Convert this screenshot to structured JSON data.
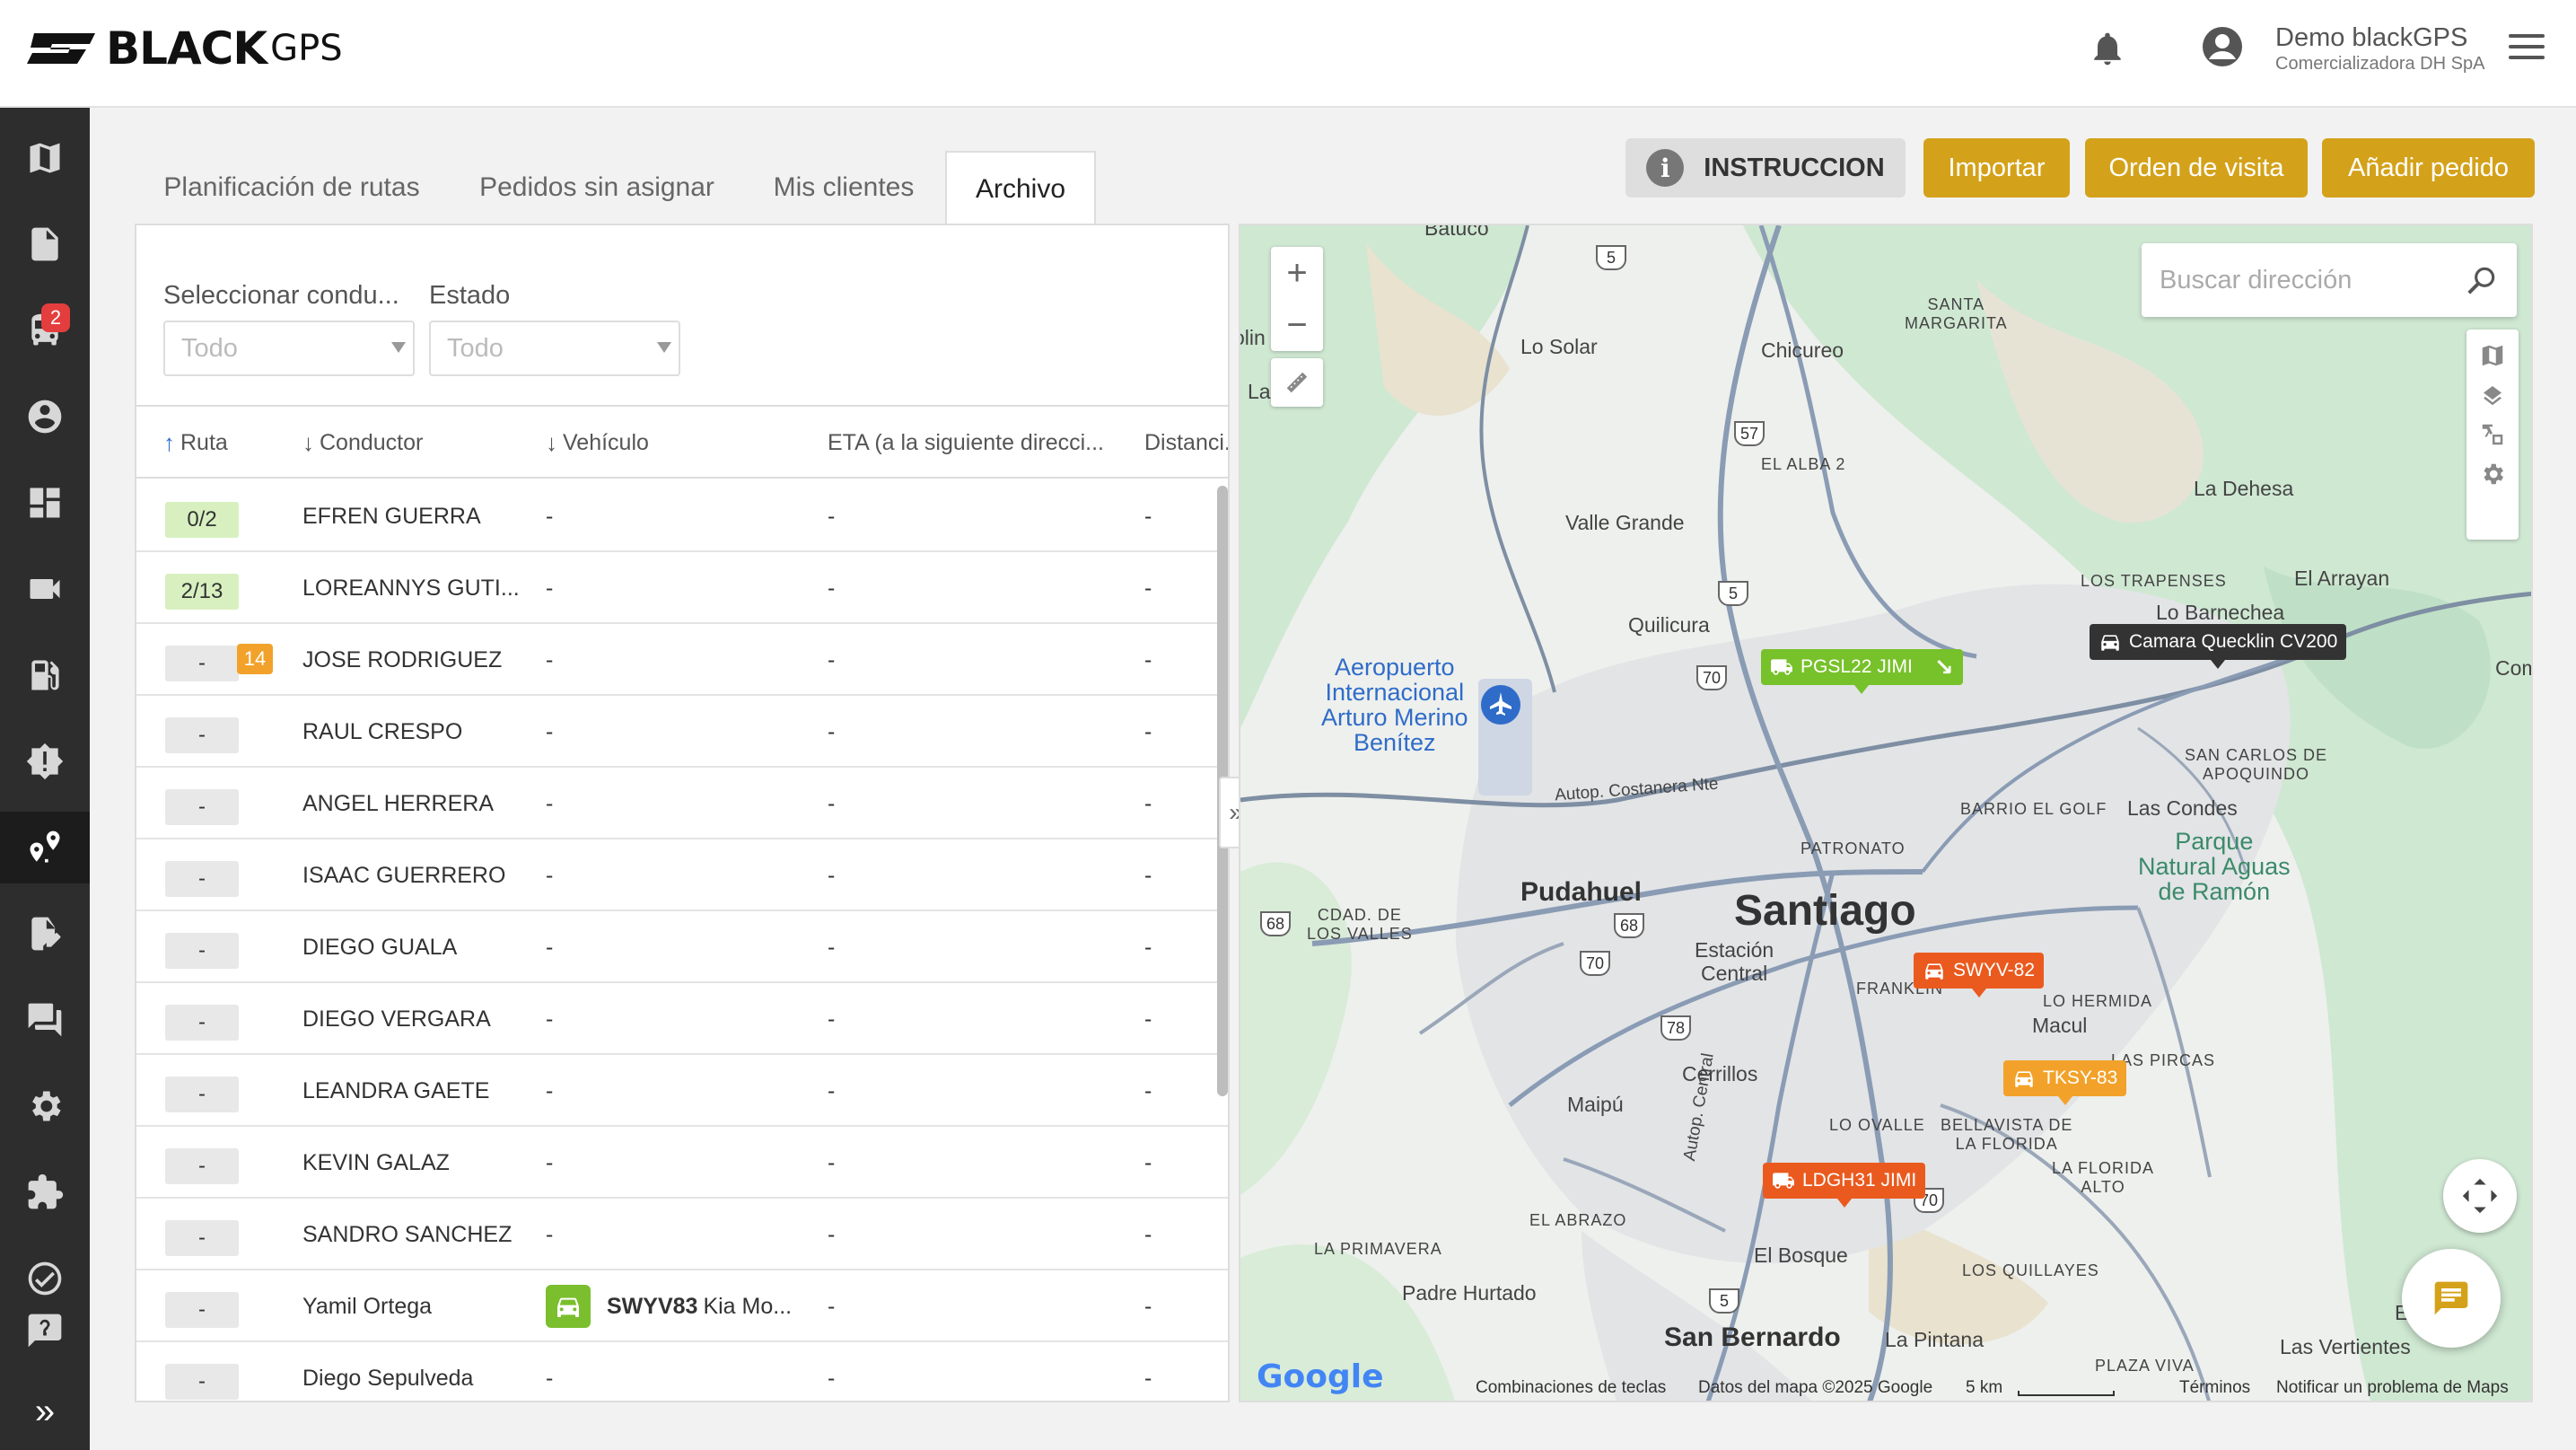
{
  "brand": {
    "name": "BLACK",
    "suffix": "GPS"
  },
  "user": {
    "name": "Demo blackGPS",
    "company": "Comercializadora DH SpA"
  },
  "sidebar": {
    "items": [
      {
        "icon": "map-icon"
      },
      {
        "icon": "document-icon"
      },
      {
        "icon": "truck-icon",
        "badge": "2"
      },
      {
        "icon": "user-icon"
      },
      {
        "icon": "dashboard-icon"
      },
      {
        "icon": "video-icon"
      },
      {
        "icon": "fuel-icon"
      },
      {
        "icon": "alert-icon"
      },
      {
        "icon": "route-icon",
        "active": true
      },
      {
        "icon": "edit-doc-icon"
      },
      {
        "icon": "chat-icon"
      },
      {
        "icon": "settings-icon"
      },
      {
        "icon": "plugin-icon"
      },
      {
        "icon": "check-circle-icon"
      },
      {
        "icon": "help-icon"
      }
    ]
  },
  "tabs": [
    {
      "label": "Planificación de rutas"
    },
    {
      "label": "Pedidos sin asignar"
    },
    {
      "label": "Mis clientes"
    },
    {
      "label": "Archivo",
      "active": true
    }
  ],
  "actions": {
    "instruction": "INSTRUCCION",
    "import": "Importar",
    "visit_order": "Orden de visita",
    "add_order": "Añadir pedido"
  },
  "filters": {
    "driver_label": "Seleccionar condu...",
    "driver_value": "Todo",
    "status_label": "Estado",
    "status_value": "Todo"
  },
  "table": {
    "columns": [
      "Ruta",
      "Conductor",
      "Vehículo",
      "ETA (a la siguiente direcci...",
      "Distanci..."
    ],
    "rows": [
      {
        "route": "0/2",
        "route_green": true,
        "driver": "EFREN GUERRA",
        "vehicle": "-",
        "eta": "-",
        "distance": "-"
      },
      {
        "route": "2/13",
        "route_green": true,
        "driver": "LOREANNYS GUTI...",
        "vehicle": "-",
        "eta": "-",
        "distance": "-"
      },
      {
        "route": "-",
        "badge": "14",
        "driver": "JOSE RODRIGUEZ",
        "vehicle": "-",
        "eta": "-",
        "distance": "-"
      },
      {
        "route": "-",
        "driver": "RAUL CRESPO",
        "vehicle": "-",
        "eta": "-",
        "distance": "-"
      },
      {
        "route": "-",
        "driver": "ANGEL HERRERA",
        "vehicle": "-",
        "eta": "-",
        "distance": "-"
      },
      {
        "route": "-",
        "driver": "ISAAC GUERRERO",
        "vehicle": "-",
        "eta": "-",
        "distance": "-"
      },
      {
        "route": "-",
        "driver": "DIEGO GUALA",
        "vehicle": "-",
        "eta": "-",
        "distance": "-"
      },
      {
        "route": "-",
        "driver": "DIEGO VERGARA",
        "vehicle": "-",
        "eta": "-",
        "distance": "-"
      },
      {
        "route": "-",
        "driver": "LEANDRA GAETE",
        "vehicle": "-",
        "eta": "-",
        "distance": "-"
      },
      {
        "route": "-",
        "driver": "KEVIN GALAZ",
        "vehicle": "-",
        "eta": "-",
        "distance": "-"
      },
      {
        "route": "-",
        "driver": "SANDRO SANCHEZ",
        "vehicle": "-",
        "eta": "-",
        "distance": "-"
      },
      {
        "route": "-",
        "driver": "Yamil Ortega",
        "vehicle_plate": "SWYV83",
        "vehicle_model": "Kia Mo...",
        "eta": "-",
        "distance": "-"
      },
      {
        "route": "-",
        "driver": "Diego Sepulveda",
        "vehicle": "-",
        "eta": "-",
        "distance": "-"
      }
    ]
  },
  "map": {
    "search_placeholder": "Buscar dirección",
    "labels": {
      "batuco": "Batuco",
      "lo_solar": "Lo Solar",
      "chicureo": "Chicureo",
      "santa_margarita": "SANTA\nMARGARITA",
      "la": "La",
      "lin": "olin",
      "el_alba": "EL ALBA 2",
      "la_dehesa": "La Dehesa",
      "valle_grande": "Valle Grande",
      "los_trapenses": "LOS TRAPENSES",
      "el_arrayan": "El Arrayan",
      "lo_barnechea": "Lo Barnechea",
      "quilicura": "Quilicura",
      "airport": "Aeropuerto\nInternacional\nArturo Merino\nBenítez",
      "come": "Come",
      "san_carlos": "SAN CARLOS DE\nAPOQUINDO",
      "barrio_golf": "BARRIO EL GOLF",
      "las_condes": "Las Condes",
      "parque": "Parque\nNatural Aguas\nde Ramón",
      "costanera": "Autop. Costanera Nte",
      "patronato": "PATRONATO",
      "pudahuel": "Pudahuel",
      "santiago": "Santiago",
      "ciudad_valles": "CDAD. DE\nLOS VALLES",
      "estacion": "Estación\nCentral",
      "franklin": "FRANKLIN",
      "lo_hermida": "LO HERMIDA",
      "macul": "Macul",
      "las_pircas": "LAS PIRCAS",
      "cerrillos": "Cerrillos",
      "maipu": "Maipú",
      "lo_ovalle": "LO OVALLE",
      "bellavista": "BELLAVISTA DE\nLA FLORIDA",
      "la_florida_alto": "LA FLORIDA\nALTO",
      "el_abrazo": "EL ABRAZO",
      "la_primavera": "LA PRIMAVERA",
      "el_bosque": "El Bosque",
      "los_quillayes": "LOS QUILLAYES",
      "padre_hurtado": "Padre Hurtado",
      "san_bernardo": "San Bernardo",
      "la_pintana": "La Pintana",
      "plaza_viva": "PLAZA VIVA",
      "las_vertientes": "Las Vertientes",
      "el_ca": "El Ca",
      "autop_central": "Autop. Central"
    },
    "shields": [
      "5",
      "57",
      "5",
      "70",
      "68",
      "68",
      "70",
      "78",
      "5",
      "70"
    ],
    "markers": [
      {
        "label": "PGSL22 JIMI",
        "color": "green"
      },
      {
        "label": "Camara Quecklin CV200",
        "color": "dark"
      },
      {
        "label": "SWYV-82",
        "color": "red"
      },
      {
        "label": "TKSY-83",
        "color": "orange"
      },
      {
        "label": "LDGH31 JIMI",
        "color": "red"
      }
    ],
    "footer": {
      "google": "Google",
      "shortcuts": "Combinaciones de teclas",
      "data": "Datos del mapa ©2025 Google",
      "scale": "5 km",
      "terms": "Términos",
      "report": "Notificar un problema de Maps"
    }
  }
}
